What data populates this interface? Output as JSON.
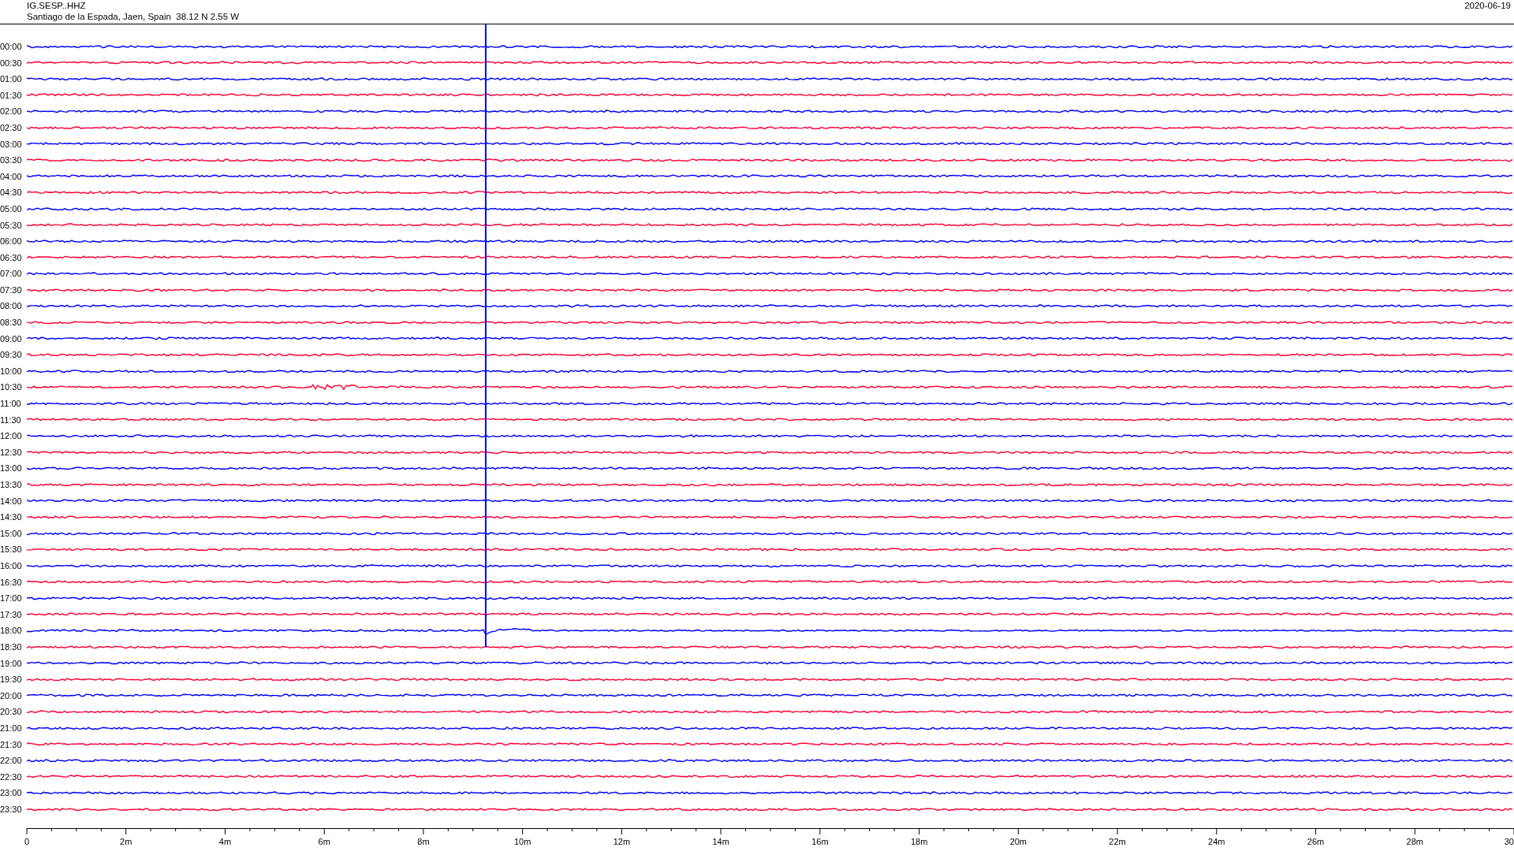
{
  "header": {
    "station": "IG.SESP..HHZ",
    "location": "Santiago de la Espada, Jaen, Spain  38.12 N 2.55 W",
    "date": "2020-06-19"
  },
  "traces": [
    {
      "label": "00:00",
      "color": "#0000ff"
    },
    {
      "label": "00:30",
      "color": "#ff0033"
    },
    {
      "label": "01:00",
      "color": "#0000ff"
    },
    {
      "label": "01:30",
      "color": "#ff0033"
    },
    {
      "label": "02:00",
      "color": "#0000ff"
    },
    {
      "label": "02:30",
      "color": "#ff0033"
    },
    {
      "label": "03:00",
      "color": "#0000ff"
    },
    {
      "label": "03:30",
      "color": "#ff0033"
    },
    {
      "label": "04:00",
      "color": "#0000ff"
    },
    {
      "label": "04:30",
      "color": "#ff0033"
    },
    {
      "label": "05:00",
      "color": "#0000ff"
    },
    {
      "label": "05:30",
      "color": "#ff0033"
    },
    {
      "label": "06:00",
      "color": "#0000ff"
    },
    {
      "label": "06:30",
      "color": "#ff0033"
    },
    {
      "label": "07:00",
      "color": "#0000ff"
    },
    {
      "label": "07:30",
      "color": "#ff0033"
    },
    {
      "label": "08:00",
      "color": "#0000ff"
    },
    {
      "label": "08:30",
      "color": "#ff0033"
    },
    {
      "label": "09:00",
      "color": "#0000ff"
    },
    {
      "label": "09:30",
      "color": "#ff0033"
    },
    {
      "label": "10:00",
      "color": "#0000ff"
    },
    {
      "label": "10:30",
      "color": "#ff0033"
    },
    {
      "label": "11:00",
      "color": "#0000ff"
    },
    {
      "label": "11:30",
      "color": "#ff0033"
    },
    {
      "label": "12:00",
      "color": "#0000ff"
    },
    {
      "label": "12:30",
      "color": "#ff0033"
    },
    {
      "label": "13:00",
      "color": "#0000ff"
    },
    {
      "label": "13:30",
      "color": "#ff0033"
    },
    {
      "label": "14:00",
      "color": "#0000ff"
    },
    {
      "label": "14:30",
      "color": "#ff0033"
    },
    {
      "label": "15:00",
      "color": "#0000ff"
    },
    {
      "label": "15:30",
      "color": "#ff0033"
    },
    {
      "label": "16:00",
      "color": "#0000ff"
    },
    {
      "label": "16:30",
      "color": "#ff0033"
    },
    {
      "label": "17:00",
      "color": "#0000ff"
    },
    {
      "label": "17:30",
      "color": "#ff0033"
    },
    {
      "label": "18:00",
      "color": "#0000ff"
    },
    {
      "label": "18:30",
      "color": "#ff0033"
    },
    {
      "label": "19:00",
      "color": "#0000ff"
    },
    {
      "label": "19:30",
      "color": "#ff0033"
    },
    {
      "label": "20:00",
      "color": "#0000ff"
    },
    {
      "label": "20:30",
      "color": "#ff0033"
    },
    {
      "label": "21:00",
      "color": "#0000ff"
    },
    {
      "label": "21:30",
      "color": "#ff0033"
    },
    {
      "label": "22:00",
      "color": "#0000ff"
    },
    {
      "label": "22:30",
      "color": "#ff0033"
    },
    {
      "label": "23:00",
      "color": "#0000ff"
    },
    {
      "label": "23:30",
      "color": "#ff0033"
    }
  ],
  "x_axis": {
    "ticks": [
      "0",
      "2m",
      "4m",
      "6m",
      "8m",
      "10m",
      "12m",
      "14m",
      "16m",
      "18m",
      "20m",
      "22m",
      "24m",
      "26m",
      "28m",
      "30"
    ]
  }
}
